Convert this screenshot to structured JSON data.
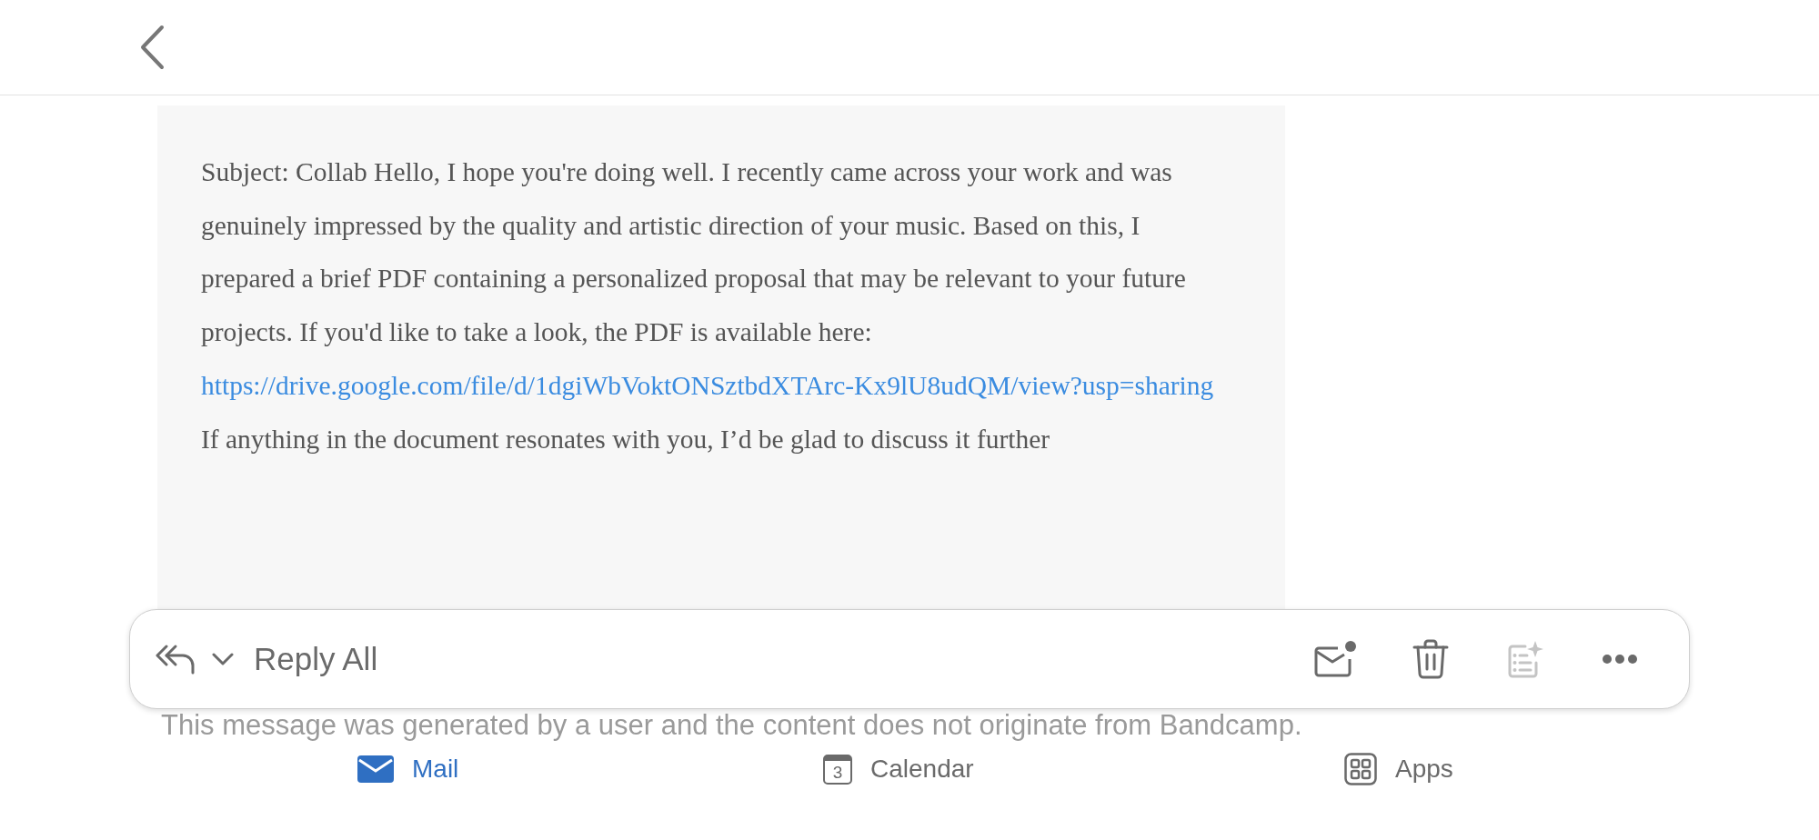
{
  "message": {
    "body_start": "Subject: Collab Hello, I hope you're doing well. I recently came across your work and was genuinely impressed by the quality and artistic direction of your music. Based on this, I prepared a brief PDF containing a personalized proposal that may be relevant to your future projects. If you'd like to take a look, the PDF is available here:",
    "link": "https://drive.google.com/file/d/1dgiWbVoktONSztbdXTArc-Kx9lU8udQM/view?usp=sharing",
    "body_end": " If anything in the document resonates with you, I’d be glad to discuss it further"
  },
  "disclaimer": "This message was generated by a user and the content does not originate from Bandcamp.",
  "action_bar": {
    "reply_label": "Reply All",
    "actions": [
      {
        "kind": "mark-unread",
        "disabled": false
      },
      {
        "kind": "delete",
        "disabled": false
      },
      {
        "kind": "summarize",
        "disabled": true
      },
      {
        "kind": "more",
        "disabled": false
      }
    ]
  },
  "tabs": [
    {
      "kind": "mail",
      "label": "Mail",
      "selected": true
    },
    {
      "kind": "calendar",
      "label": "Calendar",
      "icon_text": "3",
      "selected": false
    },
    {
      "kind": "apps",
      "label": "Apps",
      "selected": false
    }
  ]
}
